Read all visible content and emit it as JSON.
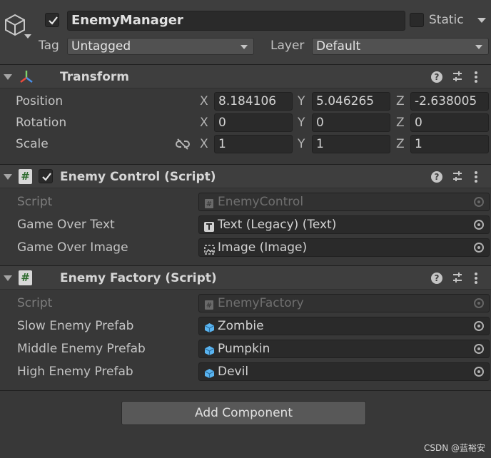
{
  "header": {
    "object_name": "EnemyManager",
    "active": true,
    "static_label": "Static",
    "tag_label": "Tag",
    "tag_value": "Untagged",
    "layer_label": "Layer",
    "layer_value": "Default"
  },
  "transform": {
    "title": "Transform",
    "rows": [
      {
        "label": "Position",
        "x": "8.184106",
        "y": "5.046265",
        "z": "-2.638005"
      },
      {
        "label": "Rotation",
        "x": "0",
        "y": "0",
        "z": "0"
      },
      {
        "label": "Scale",
        "x": "1",
        "y": "1",
        "z": "1"
      }
    ],
    "axis": {
      "x": "X",
      "y": "Y",
      "z": "Z"
    }
  },
  "enemy_control": {
    "title": "Enemy Control (Script)",
    "enabled": true,
    "script_label": "Script",
    "script_value": "EnemyControl",
    "fields": [
      {
        "label": "Game Over Text",
        "value": "Text (Legacy) (Text)",
        "icon": "text-component-icon"
      },
      {
        "label": "Game Over Image",
        "value": "Image (Image)",
        "icon": "image-component-icon"
      }
    ]
  },
  "enemy_factory": {
    "title": "Enemy Factory (Script)",
    "script_label": "Script",
    "script_value": "EnemyFactory",
    "fields": [
      {
        "label": "Slow Enemy Prefab",
        "value": "Zombie",
        "icon": "prefab-cube-icon"
      },
      {
        "label": "Middle Enemy Prefab",
        "value": "Pumpkin",
        "icon": "prefab-cube-icon"
      },
      {
        "label": "High Enemy Prefab",
        "value": "Devil",
        "icon": "prefab-cube-icon"
      }
    ]
  },
  "add_component_label": "Add Component",
  "watermark": "CSDN @蓝裕安",
  "colors": {
    "background": "#383838",
    "header_bg": "#3e3e3e",
    "field_bg": "#2a2a2a",
    "prefab_blue": "#5ab4f0"
  }
}
